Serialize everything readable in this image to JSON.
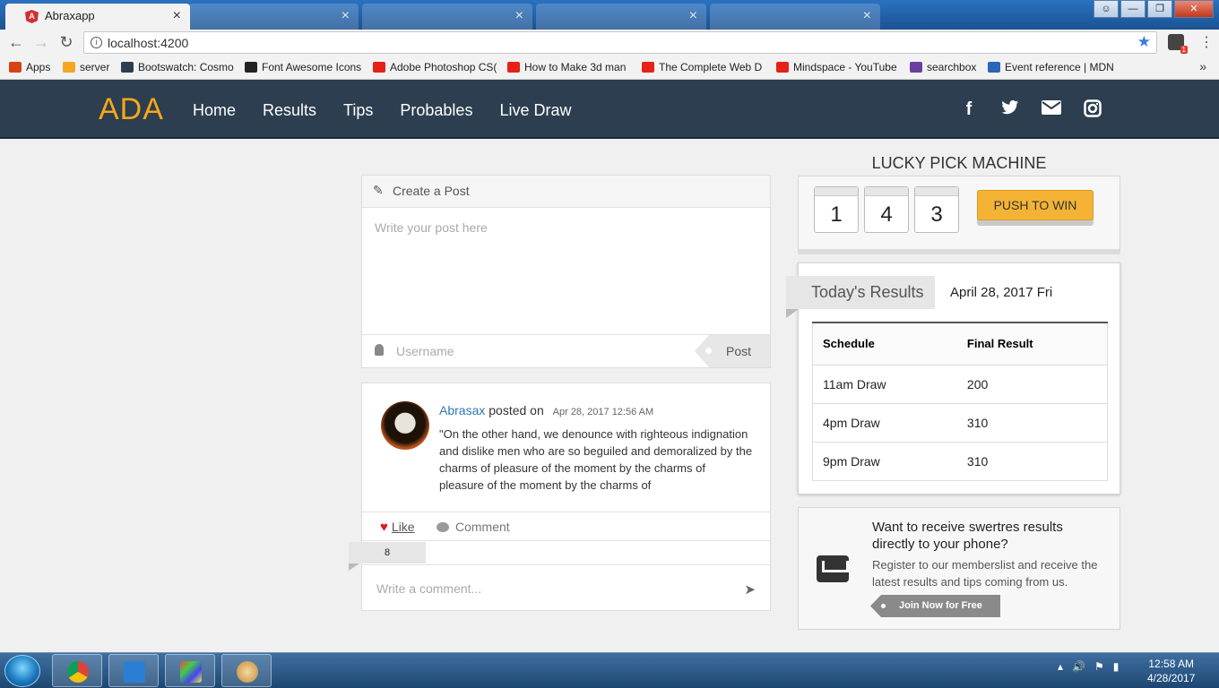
{
  "browser": {
    "active_tab_title": "Abraxapp",
    "tab_close_glyph": "×",
    "url": "localhost:4200",
    "bookmarks": [
      {
        "label": "Apps",
        "color": "#d84315"
      },
      {
        "label": "server",
        "color": "#f5a623"
      },
      {
        "label": "Bootswatch: Cosmo",
        "color": "#2c3e50"
      },
      {
        "label": "Font Awesome Icons",
        "color": "#222222"
      },
      {
        "label": "Adobe Photoshop CS(",
        "color": "#e62117"
      },
      {
        "label": "How to Make 3d man",
        "color": "#e62117"
      },
      {
        "label": "The Complete Web D",
        "color": "#e62117"
      },
      {
        "label": "Mindspace - YouTube",
        "color": "#e62117"
      },
      {
        "label": "searchbox",
        "color": "#6a3fa0"
      },
      {
        "label": "Event reference | MDN",
        "color": "#2a66b4"
      }
    ],
    "more_glyph": "»"
  },
  "site": {
    "logo": "ADA",
    "nav": [
      "Home",
      "Results",
      "Tips",
      "Probables",
      "Live Draw"
    ],
    "social_icons": [
      "facebook-icon",
      "twitter-icon",
      "envelope-icon",
      "instagram-icon"
    ]
  },
  "create_post": {
    "header": "Create a Post",
    "textarea_placeholder": "Write your post here",
    "username_placeholder": "Username",
    "post_button": "Post"
  },
  "post": {
    "author": "Abrasax",
    "posted_on": "posted on",
    "date": "Apr 28, 2017 12:56 AM",
    "text": "\"On the other hand, we denounce with righteous indignation and dislike men who are so beguiled and demoralized by the charms of pleasure of the moment by the charms of pleasure of the moment by the charms of",
    "like_label": "Like",
    "comment_label": "Comment",
    "like_count": "8",
    "comment_placeholder": "Write a comment..."
  },
  "lucky_pick": {
    "title": "LUCKY PICK MACHINE",
    "digits": [
      "1",
      "4",
      "3"
    ],
    "button": "PUSH TO WIN"
  },
  "results": {
    "label": "Today's Results",
    "date": "April 28, 2017  Fri",
    "headers": [
      "Schedule",
      "Final Result"
    ],
    "rows": [
      {
        "schedule": "11am Draw",
        "result": "200"
      },
      {
        "schedule": "4pm Draw",
        "result": "310"
      },
      {
        "schedule": "9pm Draw",
        "result": "310"
      }
    ]
  },
  "signup": {
    "title": "Want to receive swertres results directly to your phone?",
    "text": "Register to our memberslist and receive the latest results and tips coming from us.",
    "button": "Join Now for Free"
  },
  "taskbar": {
    "time": "12:58 AM",
    "date": "4/28/2017"
  }
}
